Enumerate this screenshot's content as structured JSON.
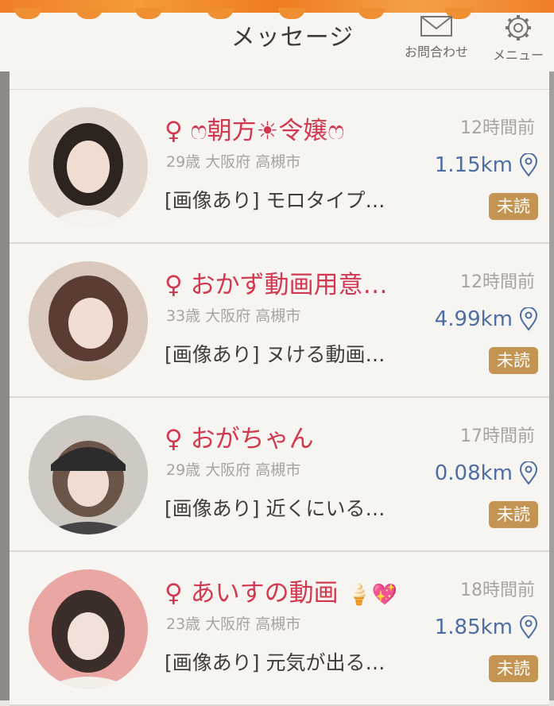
{
  "header": {
    "title": "メッセージ",
    "contact_label": "お問合わせ",
    "menu_label": "メニュー"
  },
  "messages": [
    {
      "name": "朝方☀令嬢",
      "prefix": "♀",
      "name_decor": "ෆ",
      "time": "12時間前",
      "meta": "29歳 大阪府 高槻市",
      "distance": "1.15km",
      "preview": "[画像あり] モロタイプ…",
      "badge": "未読"
    },
    {
      "name": "おかず動画用意…",
      "prefix": "♀",
      "time": "12時間前",
      "meta": "33歳 大阪府 高槻市",
      "distance": "4.99km",
      "preview": "[画像あり] ヌける動画…",
      "badge": "未読"
    },
    {
      "name": "おがちゃん",
      "prefix": "♀",
      "time": "17時間前",
      "meta": "29歳 大阪府 高槻市",
      "distance": "0.08km",
      "preview": "[画像あり] 近くにいる…",
      "badge": "未読"
    },
    {
      "name": "あいすの動画",
      "prefix": "♀",
      "emoji": "🍦💖",
      "time": "18時間前",
      "meta": "23歳 大阪府 高槻市",
      "distance": "1.85km",
      "preview": "[画像あり] 元気が出る…",
      "badge": "未読"
    }
  ],
  "colors": {
    "accent_orange": "#f08e32",
    "name_pink": "#d2384f",
    "distance_blue": "#4d6da3",
    "badge_gold": "#c49452"
  },
  "icons": [
    "mail-icon",
    "gear-icon",
    "location-pin-icon",
    "venus-icon"
  ]
}
